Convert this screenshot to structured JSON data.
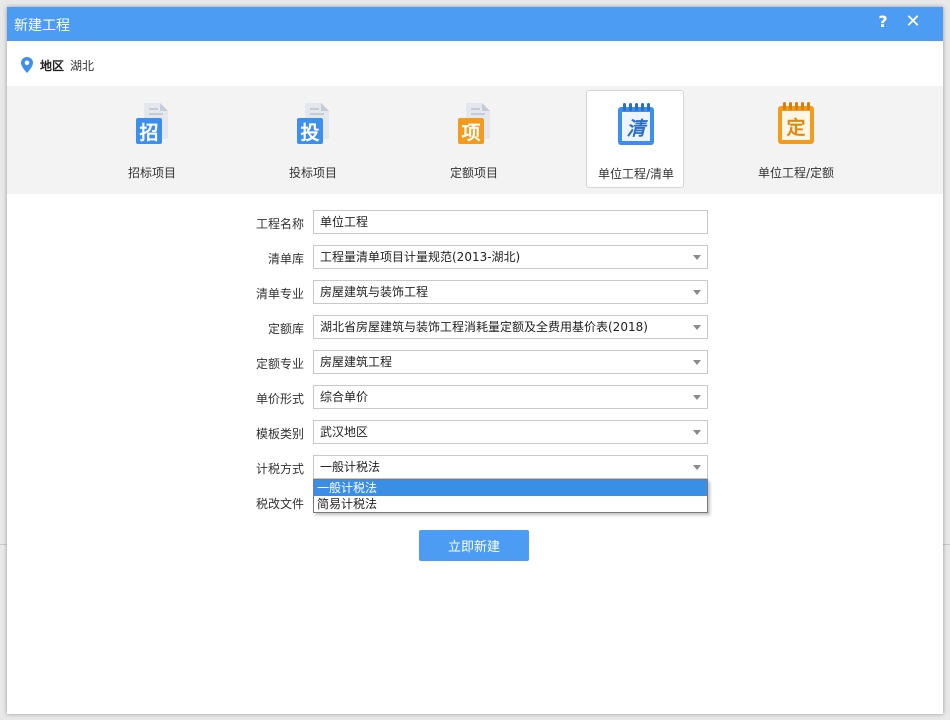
{
  "dialog": {
    "title": "新建工程",
    "help_label": "?",
    "close_label": "✕"
  },
  "region": {
    "label": "地区",
    "value": "湖北"
  },
  "project_types": [
    {
      "glyph": "招",
      "label": "招标项目",
      "icon": "zhao-document-icon",
      "color": "#3d8fee"
    },
    {
      "glyph": "投",
      "label": "投标项目",
      "icon": "tou-document-icon",
      "color": "#3d8fee"
    },
    {
      "glyph": "项",
      "label": "定额项目",
      "icon": "xiang-document-icon",
      "color": "#f29b1d"
    },
    {
      "glyph": "清",
      "label": "单位工程/清单",
      "icon": "qing-notebook-icon",
      "color": "#3d8fee"
    },
    {
      "glyph": "定",
      "label": "单位工程/定额",
      "icon": "ding-notebook-icon",
      "color": "#f29b1d"
    }
  ],
  "form": {
    "project_name": {
      "label": "工程名称",
      "value": "单位工程"
    },
    "bill_library": {
      "label": "清单库",
      "value": "工程量清单项目计量规范(2013-湖北)"
    },
    "bill_specialty": {
      "label": "清单专业",
      "value": "房屋建筑与装饰工程"
    },
    "quota_library": {
      "label": "定额库",
      "value": "湖北省房屋建筑与装饰工程消耗量定额及全费用基价表(2018)"
    },
    "quota_specialty": {
      "label": "定额专业",
      "value": "房屋建筑工程"
    },
    "unit_price_form": {
      "label": "单价形式",
      "value": "综合单价"
    },
    "template_category": {
      "label": "模板类别",
      "value": "武汉地区"
    },
    "tax_method": {
      "label": "计税方式",
      "value": "一般计税法",
      "options": [
        "一般计税法",
        "简易计税法"
      ]
    },
    "tax_reform_file": {
      "label": "税改文件"
    }
  },
  "create_button": "立即新建"
}
